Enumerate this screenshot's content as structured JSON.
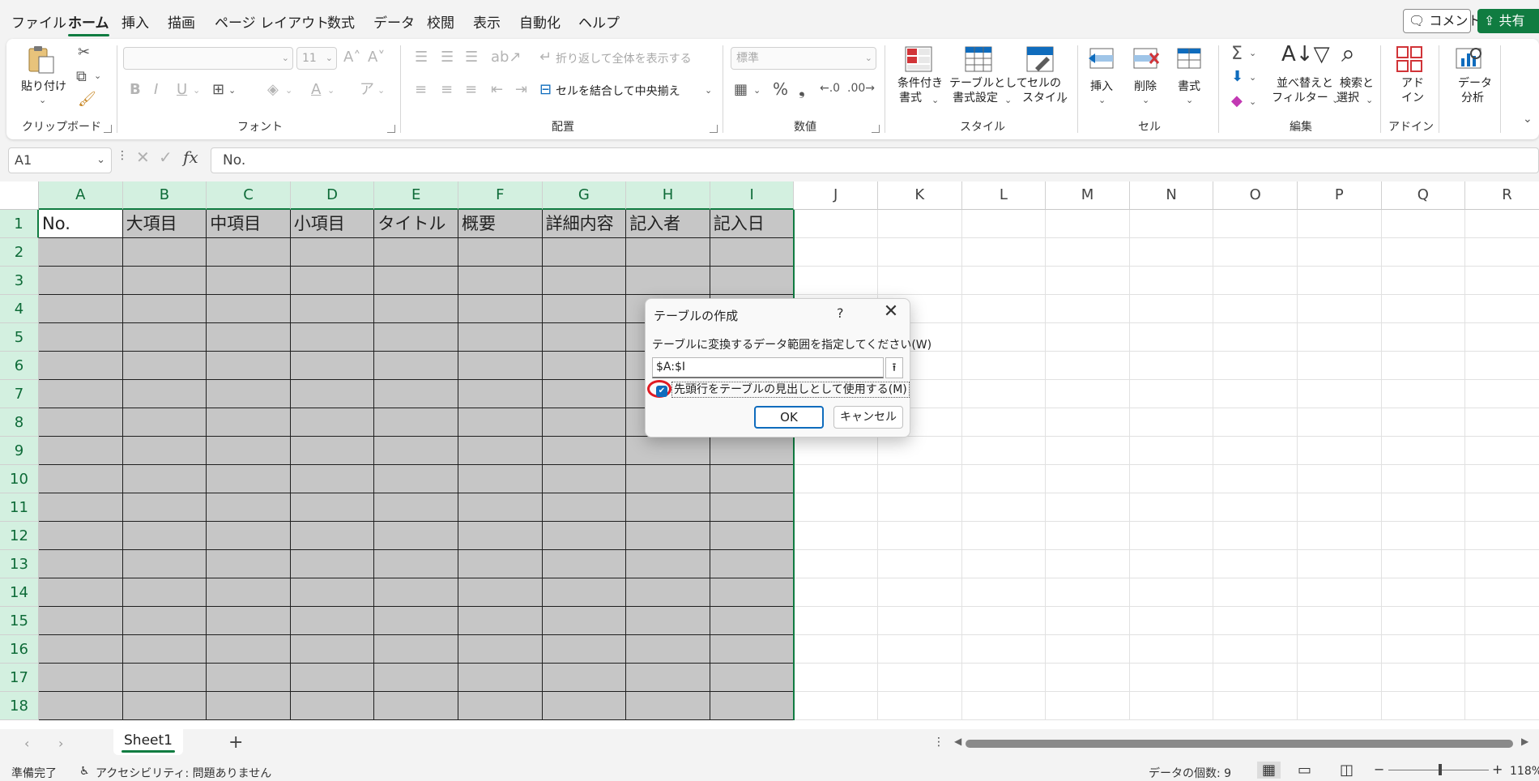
{
  "menu": {
    "tabs": [
      "ファイル",
      "ホーム",
      "挿入",
      "描画",
      "ページ レイアウト",
      "数式",
      "データ",
      "校閲",
      "表示",
      "自動化",
      "ヘルプ"
    ],
    "active_tab": "ホーム",
    "comment_label": "コメント",
    "share_label": "共有"
  },
  "ribbon": {
    "clipboard": {
      "label": "クリップボード",
      "paste_label": "貼り付け"
    },
    "font": {
      "label": "フォント",
      "font_name": "",
      "font_size": "11"
    },
    "alignment": {
      "label": "配置",
      "wrap_label": "折り返して全体を表示する",
      "merge_label": "セルを結合して中央揃え"
    },
    "number": {
      "label": "数値",
      "format": "標準"
    },
    "styles": {
      "label": "スタイル",
      "conditional_l1": "条件付き",
      "conditional_l2": "書式",
      "table_l1": "テーブルとして",
      "table_l2": "書式設定",
      "cellstyle_l1": "セルの",
      "cellstyle_l2": "スタイル"
    },
    "cells": {
      "label": "セル",
      "insert": "挿入",
      "delete": "削除",
      "format": "書式"
    },
    "editing": {
      "label": "編集",
      "sort_l1": "並べ替えと",
      "sort_l2": "フィルター",
      "find_l1": "検索と",
      "find_l2": "選択"
    },
    "addins": {
      "label": "アドイン",
      "btn_l1": "アド",
      "btn_l2": "イン"
    },
    "analysis": {
      "btn_l1": "データ",
      "btn_l2": "分析"
    }
  },
  "formula_bar": {
    "name_box": "A1",
    "formula": "No.",
    "fx": "fx"
  },
  "sheet": {
    "columns": [
      "A",
      "B",
      "C",
      "D",
      "E",
      "F",
      "G",
      "H",
      "I",
      "J",
      "K",
      "L",
      "M",
      "N",
      "O",
      "P",
      "Q",
      "R"
    ],
    "rows": [
      "1",
      "2",
      "3",
      "4",
      "5",
      "6",
      "7",
      "8",
      "9",
      "10",
      "11",
      "12",
      "13",
      "14",
      "15",
      "16",
      "17",
      "18"
    ],
    "header_row": [
      "No.",
      "大項目",
      "中項目",
      "小項目",
      "タイトル",
      "概要",
      "詳細内容",
      "記入者",
      "記入日"
    ],
    "selected_columns": 9
  },
  "dialog": {
    "title": "テーブルの作成",
    "help": "?",
    "prompt": "テーブルに変換するデータ範囲を指定してください(W)",
    "range_value": "$A:$I",
    "checkbox_label": "先頭行をテーブルの見出しとして使用する(M)",
    "checkbox_checked": true,
    "ok_label": "OK",
    "cancel_label": "キャンセル"
  },
  "sheet_tabs": {
    "active": "Sheet1",
    "add_label": "+"
  },
  "status": {
    "ready": "準備完了",
    "accessibility": "アクセシビリティ: 問題ありません",
    "count": "データの個数: 9",
    "zoom": "118%"
  },
  "colors": {
    "accent": "#107c41",
    "selection_fill": "#c6c6c6",
    "annotation": "#e01b24",
    "checkbox": "#0f6cbd"
  }
}
